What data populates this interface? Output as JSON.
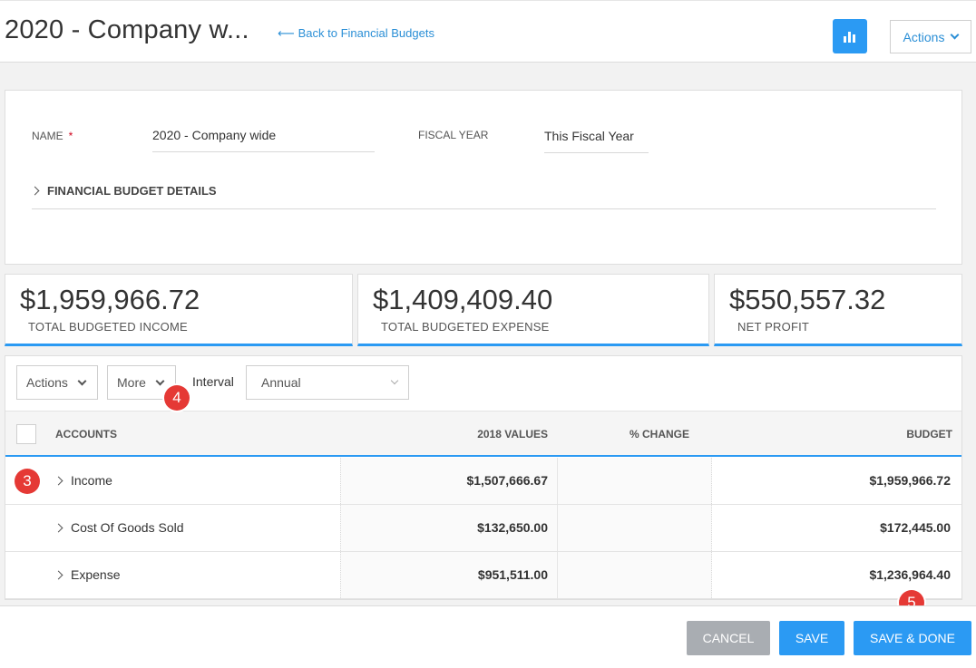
{
  "header": {
    "title": "2020 - Company w...",
    "back_link": "Back to Financial Budgets",
    "back_arrow": "⟵",
    "actions_label": "Actions"
  },
  "form": {
    "name_label": "NAME",
    "required_mark": "*",
    "name_value": "2020 - Company wide",
    "fiscal_year_label": "FISCAL YEAR",
    "fiscal_year_value": "This Fiscal Year",
    "details_label": "FINANCIAL BUDGET DETAILS"
  },
  "summary": [
    {
      "amount": "$1,959,966.72",
      "caption": "TOTAL BUDGETED INCOME"
    },
    {
      "amount": "$1,409,409.40",
      "caption": "TOTAL BUDGETED EXPENSE"
    },
    {
      "amount": "$550,557.32",
      "caption": "NET PROFIT"
    }
  ],
  "toolbar": {
    "actions_label": "Actions",
    "more_label": "More",
    "interval_label": "Interval",
    "interval_value": "Annual"
  },
  "table": {
    "columns": {
      "accounts": "ACCOUNTS",
      "values_2018": "2018 VALUES",
      "pct_change": "% CHANGE",
      "budget": "BUDGET"
    },
    "rows": [
      {
        "name": "Income",
        "values_2018": "$1,507,666.67",
        "pct_change": "",
        "budget": "$1,959,966.72"
      },
      {
        "name": "Cost Of Goods Sold",
        "values_2018": "$132,650.00",
        "pct_change": "",
        "budget": "$172,445.00"
      },
      {
        "name": "Expense",
        "values_2018": "$951,511.00",
        "pct_change": "",
        "budget": "$1,236,964.40"
      }
    ]
  },
  "badges": {
    "b3": "3",
    "b4": "4",
    "b5": "5"
  },
  "footer": {
    "cancel_label": "CANCEL",
    "save_label": "SAVE",
    "save_done_label": "SAVE & DONE"
  },
  "colors": {
    "accent": "#2b9af3",
    "link": "#2b8fd6",
    "cancel": "#a9adb2",
    "badge": "#e53935"
  },
  "icons": {
    "chart_button": "bar-chart-icon",
    "dropdown": "chevron-down-icon",
    "expand": "chevron-right-icon"
  }
}
